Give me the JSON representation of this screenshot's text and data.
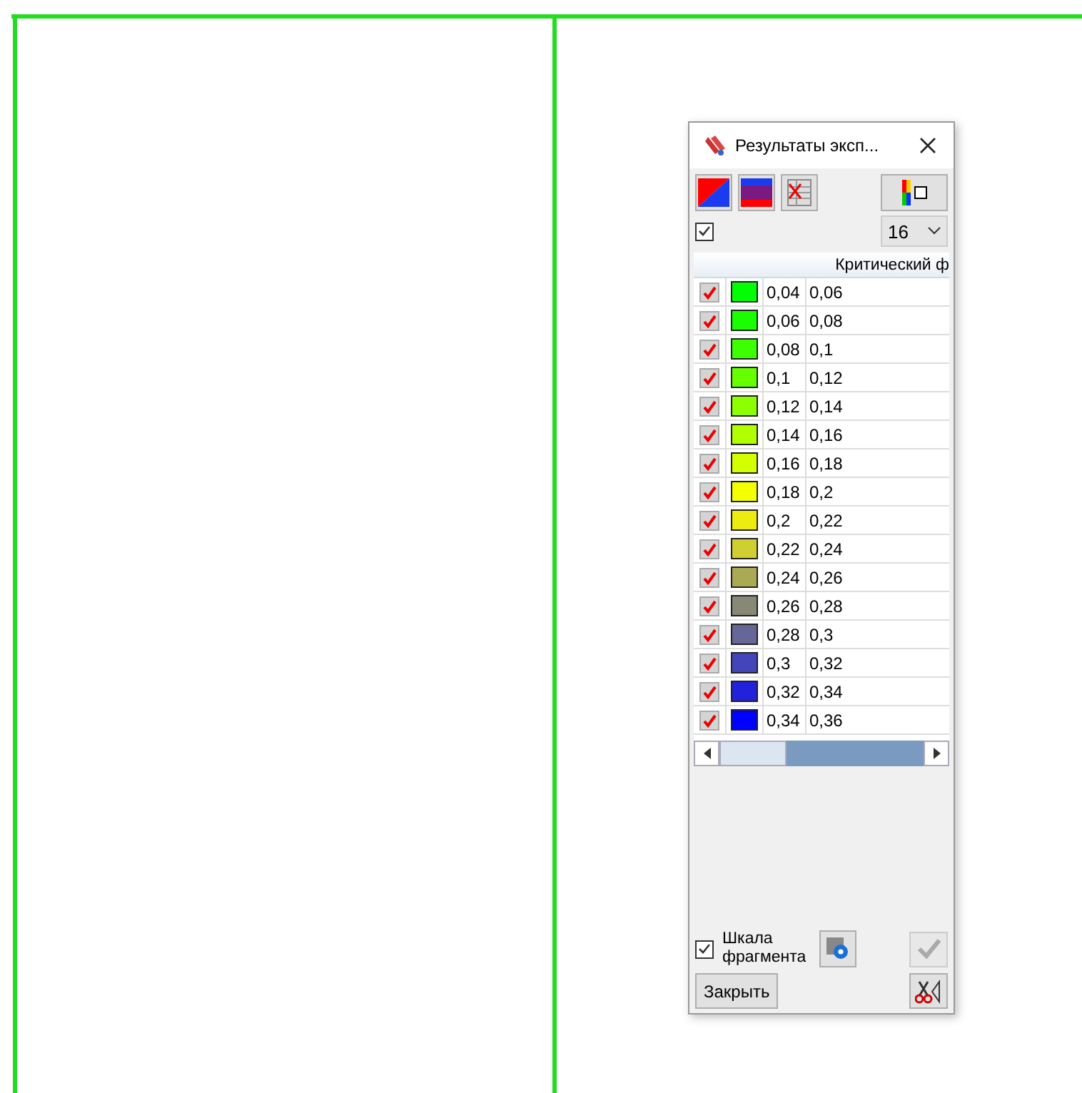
{
  "window": {
    "title": "Результаты эксп..."
  },
  "toolbar": {
    "show_all": {
      "checked": true
    },
    "count": "16"
  },
  "table": {
    "column_header": "Критический ф",
    "rows": [
      {
        "checked": true,
        "color": "#00ff00",
        "from": "0,04",
        "to": "0,06"
      },
      {
        "checked": true,
        "color": "#1aff00",
        "from": "0,06",
        "to": "0,08"
      },
      {
        "checked": true,
        "color": "#3cff00",
        "from": "0,08",
        "to": "0,1"
      },
      {
        "checked": true,
        "color": "#66ff00",
        "from": "0,1",
        "to": "0,12"
      },
      {
        "checked": true,
        "color": "#8cff00",
        "from": "0,12",
        "to": "0,14"
      },
      {
        "checked": true,
        "color": "#b0ff00",
        "from": "0,14",
        "to": "0,16"
      },
      {
        "checked": true,
        "color": "#d4ff00",
        "from": "0,16",
        "to": "0,18"
      },
      {
        "checked": true,
        "color": "#f4ff00",
        "from": "0,18",
        "to": "0,2"
      },
      {
        "checked": true,
        "color": "#ecec10",
        "from": "0,2",
        "to": "0,22"
      },
      {
        "checked": true,
        "color": "#cfcf33",
        "from": "0,22",
        "to": "0,24"
      },
      {
        "checked": true,
        "color": "#aaaa55",
        "from": "0,24",
        "to": "0,26"
      },
      {
        "checked": true,
        "color": "#888877",
        "from": "0,26",
        "to": "0,28"
      },
      {
        "checked": true,
        "color": "#666699",
        "from": "0,28",
        "to": "0,3"
      },
      {
        "checked": true,
        "color": "#4444bb",
        "from": "0,3",
        "to": "0,32"
      },
      {
        "checked": true,
        "color": "#2222dd",
        "from": "0,32",
        "to": "0,34"
      },
      {
        "checked": true,
        "color": "#0000ff",
        "from": "0,34",
        "to": "0,36"
      }
    ]
  },
  "footer": {
    "fragment_scale": {
      "label": "Шкала фрагмента",
      "checked": true
    },
    "apply": {
      "disabled": true
    },
    "close": "Закрыть"
  }
}
